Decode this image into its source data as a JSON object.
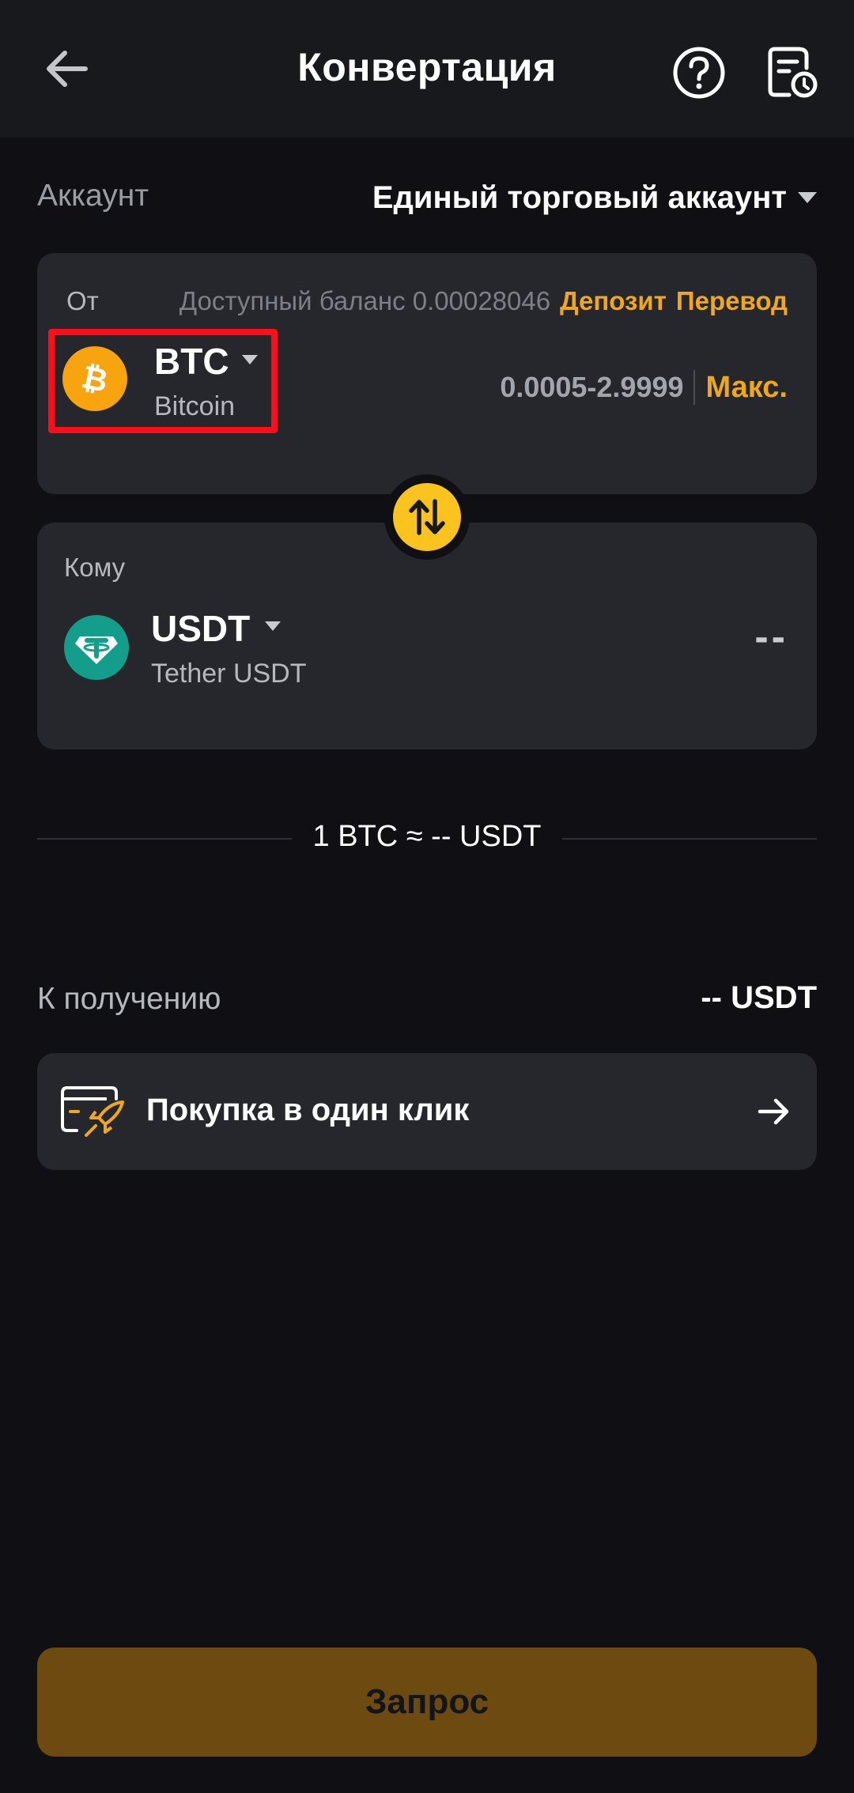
{
  "header": {
    "title": "Конвертация",
    "back_icon": "arrow-left-icon",
    "help_icon": "question-circle-icon",
    "history_icon": "order-history-icon"
  },
  "account": {
    "label": "Аккаунт",
    "value": "Единый торговый аккаунт"
  },
  "from": {
    "label": "От",
    "balance": "Доступный баланс 0.00028046",
    "deposit_link": "Депозит",
    "transfer_link": "Перевод",
    "coin": {
      "symbol": "BTC",
      "name": "Bitcoin",
      "icon": "bitcoin-icon",
      "color": "#f7a40e"
    },
    "range": "0.0005-2.9999",
    "max_label": "Макс."
  },
  "swap": {
    "icon": "swap-arrows-icon",
    "color": "#fbc31e"
  },
  "to": {
    "label": "Кому",
    "coin": {
      "symbol": "USDT",
      "name": "Tether USDT",
      "icon": "tether-icon",
      "color": "#129e8a"
    },
    "amount": "--"
  },
  "rate": {
    "text": "1 BTC ≈ -- USDT"
  },
  "receive": {
    "label": "К получению",
    "value": "-- USDT"
  },
  "one_click": {
    "label": "Покупка в один клик",
    "icon": "rocket-card-icon"
  },
  "submit": {
    "label": "Запрос"
  },
  "colors": {
    "accent": "#f0a818",
    "background": "#101014",
    "card": "#25272d"
  }
}
